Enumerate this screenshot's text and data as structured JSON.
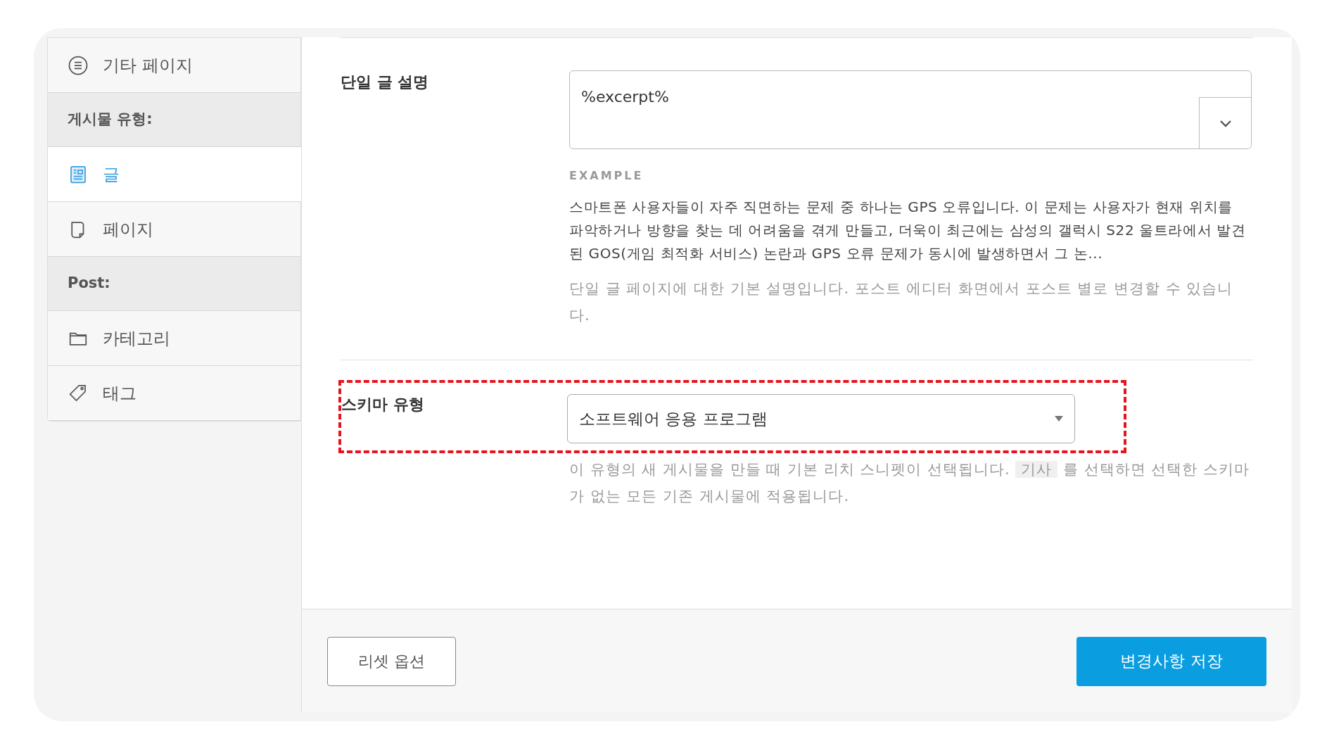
{
  "sidebar": {
    "items": [
      {
        "kind": "item",
        "label": "기타 페이지",
        "selected": false
      },
      {
        "kind": "header",
        "label": "게시물 유형:"
      },
      {
        "kind": "item",
        "label": "글",
        "selected": true
      },
      {
        "kind": "item",
        "label": "페이지",
        "selected": false
      },
      {
        "kind": "header",
        "label": "Post:"
      },
      {
        "kind": "item",
        "label": "카테고리",
        "selected": false
      },
      {
        "kind": "item",
        "label": "태그",
        "selected": false
      }
    ]
  },
  "single_description": {
    "label": "단일 글 설명",
    "value": "%excerpt%",
    "example_heading": "EXAMPLE",
    "example": "스마트폰 사용자들이 자주 직면하는 문제 중 하나는 GPS 오류입니다. 이 문제는 사용자가 현재 위치를 파악하거나 방향을 찾는 데 어려움을 겪게 만들고, 더욱이 최근에는 삼성의 갤럭시 S22 울트라에서 발견된 GOS(게임 최적화 서비스) 논란과 GPS 오류 문제가 동시에 발생하면서 그 논...",
    "help": "단일 글 페이지에 대한 기본 설명입니다. 포스트 에디터 화면에서 포스트 별로 변경할 수 있습니다."
  },
  "schema_type": {
    "label": "스키마 유형",
    "value": "소프트웨어 응용 프로그램",
    "help_before": "이 유형의 새 게시물을 만들 때 기본 리치 스니펫이 선택됩니다.",
    "help_code": "기사",
    "help_after": "를 선택하면 선택한 스키마가 없는 모든 기존 게시물에 적용됩니다."
  },
  "footer": {
    "reset_button": "리셋 옵션",
    "save_button": "변경사항 저장"
  }
}
